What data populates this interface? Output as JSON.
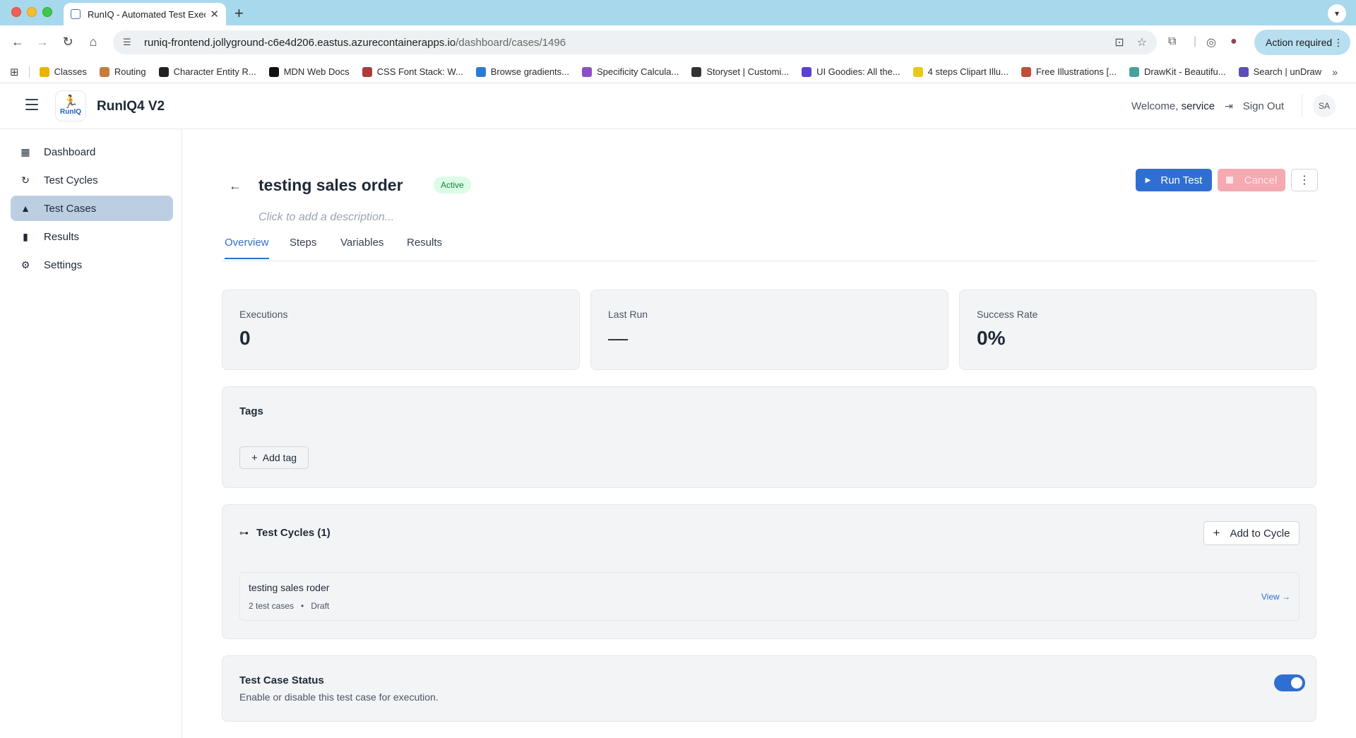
{
  "browser": {
    "tab_title": "RunIQ - Automated Test Exec",
    "url_host": "runiq-frontend.jollyground-c6e4d206.eastus.azurecontainerapps.io",
    "url_path": "/dashboard/cases/1496",
    "action_required": "Action required",
    "bookmarks": [
      {
        "label": "Classes",
        "color": "#e8b400"
      },
      {
        "label": "Routing",
        "color": "#c97b3a"
      },
      {
        "label": "Character Entity R...",
        "color": "#222222"
      },
      {
        "label": "MDN Web Docs",
        "color": "#111111"
      },
      {
        "label": "CSS Font Stack: W...",
        "color": "#b03a3a"
      },
      {
        "label": "Browse gradients...",
        "color": "#2a7bd6"
      },
      {
        "label": "Specificity Calcula...",
        "color": "#8a4fc7"
      },
      {
        "label": "Storyset | Customi...",
        "color": "#333333"
      },
      {
        "label": "UI Goodies: All the...",
        "color": "#5b3fd6"
      },
      {
        "label": "4 steps Clipart Illu...",
        "color": "#e8c81a"
      },
      {
        "label": "Free Illustrations [...",
        "color": "#c0503a"
      },
      {
        "label": "DrawKit - Beautifu...",
        "color": "#4aa0a0"
      },
      {
        "label": "Search | unDraw",
        "color": "#5b4fb5"
      }
    ]
  },
  "header": {
    "app_name": "RunIQ4 V2",
    "logo_text": "RunIQ",
    "welcome_prefix": "Welcome,",
    "username": "service",
    "sign_out": "Sign Out",
    "avatar_initials": "SA"
  },
  "sidebar": {
    "items": [
      {
        "label": "Dashboard",
        "icon": "dashboard-icon"
      },
      {
        "label": "Test Cycles",
        "icon": "refresh-icon"
      },
      {
        "label": "Test Cases",
        "icon": "flask-icon",
        "active": true
      },
      {
        "label": "Results",
        "icon": "bar-chart-icon"
      },
      {
        "label": "Settings",
        "icon": "gear-icon"
      }
    ]
  },
  "case": {
    "title": "testing sales order",
    "status_badge": "Active",
    "description_placeholder": "Click to add a description...",
    "run_test": "Run Test",
    "cancel": "Cancel"
  },
  "tabs": [
    "Overview",
    "Steps",
    "Variables",
    "Results"
  ],
  "stats": [
    {
      "label": "Executions",
      "value": "0"
    },
    {
      "label": "Last Run",
      "value": "—"
    },
    {
      "label": "Success Rate",
      "value": "0%"
    }
  ],
  "tags": {
    "title": "Tags",
    "add_label": "Add tag"
  },
  "cycles": {
    "title": "Test Cycles (1)",
    "add_label": "Add to Cycle",
    "items": [
      {
        "name": "testing sales roder",
        "count": "2 test cases",
        "status": "Draft",
        "view": "View →"
      }
    ]
  },
  "status": {
    "title": "Test Case Status",
    "description": "Enable or disable this test case for execution.",
    "enabled": true
  },
  "colors": {
    "primary": "#2f6fd1",
    "active_badge_bg": "#dcfce7",
    "active_badge_fg": "#15803d",
    "cancel_bg": "#f5a9b1",
    "sidebar_active": "#bccfe2"
  }
}
